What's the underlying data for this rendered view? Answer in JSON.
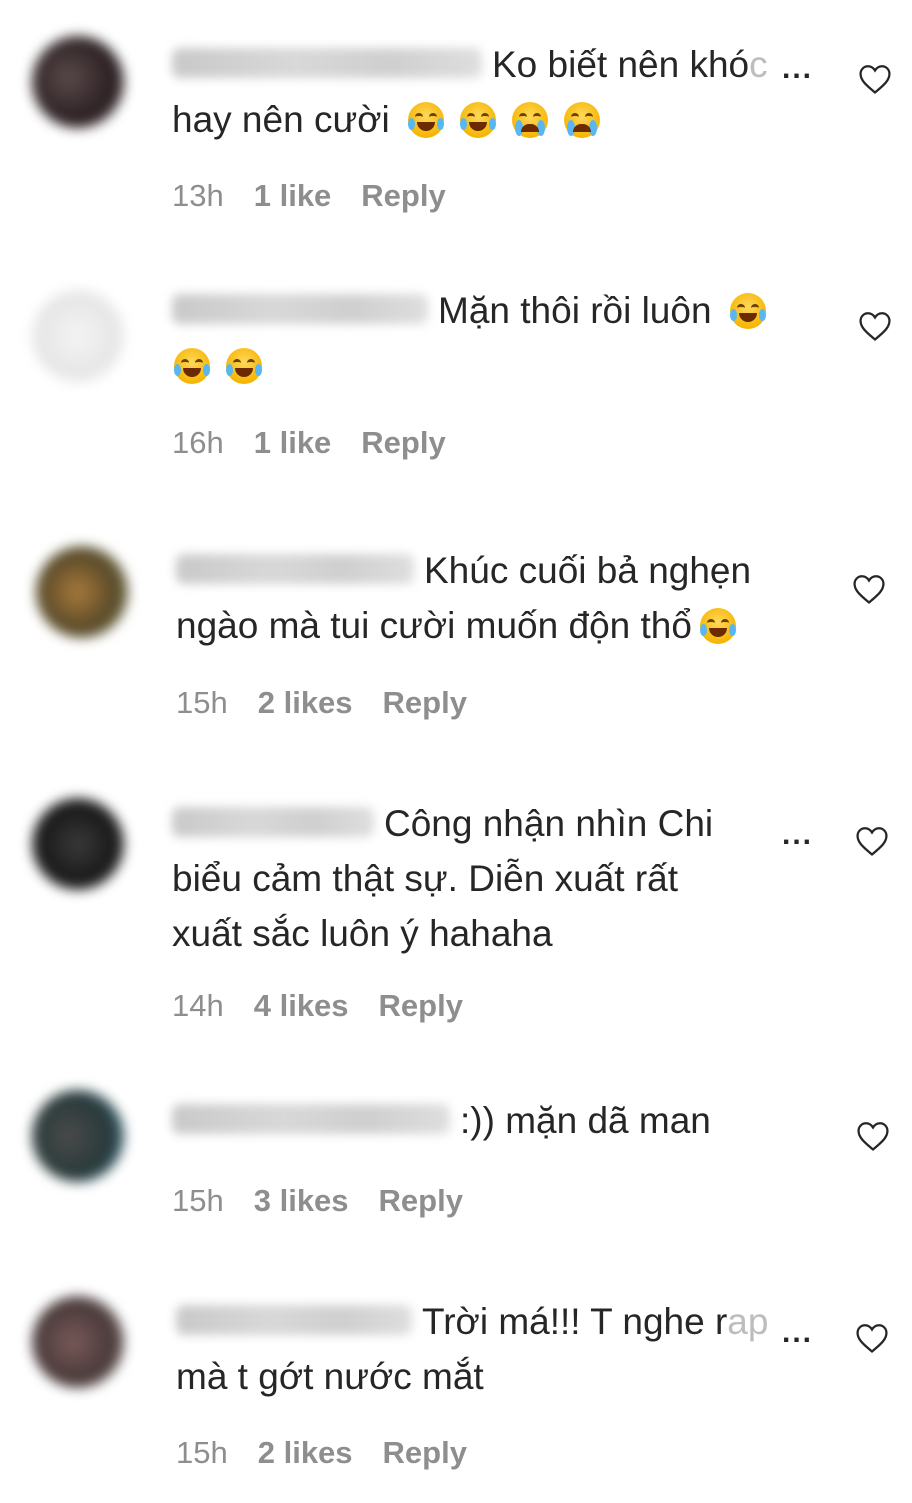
{
  "comments": [
    {
      "text_lines": [
        "Ko biết nên khó",
        "hay nên cười"
      ],
      "faded_suffix": "c",
      "emojis": [
        "face-with-tears-of-joy",
        "face-with-tears-of-joy",
        "loudly-crying-face",
        "loudly-crying-face"
      ],
      "time": "13h",
      "likes": "1 like",
      "reply": "Reply",
      "more": "..."
    },
    {
      "text_lines": [
        "Mặn thôi rồi luôn"
      ],
      "emojis": [
        "face-with-tears-of-joy",
        "face-with-tears-of-joy",
        "face-with-tears-of-joy"
      ],
      "time": "16h",
      "likes": "1 like",
      "reply": "Reply"
    },
    {
      "text_lines": [
        "Khúc cuối bả nghẹn",
        "ngào mà tui cười muốn độn thổ"
      ],
      "emojis": [
        "face-with-tears-of-joy"
      ],
      "time": "15h",
      "likes": "2 likes",
      "reply": "Reply"
    },
    {
      "text_lines": [
        "Công nhận nhìn Chi",
        "biểu cảm thật sự. Diễn xuất rất",
        "xuất sắc luôn ý hahaha"
      ],
      "time": "14h",
      "likes": "4 likes",
      "reply": "Reply",
      "more": "..."
    },
    {
      "text_lines": [
        ":)) mặn dã man"
      ],
      "time": "15h",
      "likes": "3 likes",
      "reply": "Reply"
    },
    {
      "text_lines": [
        "Trời má!!! T nghe r",
        "mà t gớt nước mắt"
      ],
      "faded_suffix": "ap",
      "time": "15h",
      "likes": "2 likes",
      "reply": "Reply",
      "more": "..."
    }
  ],
  "icons": {
    "like": "heart-outline-icon",
    "more": "more-dots-icon"
  }
}
